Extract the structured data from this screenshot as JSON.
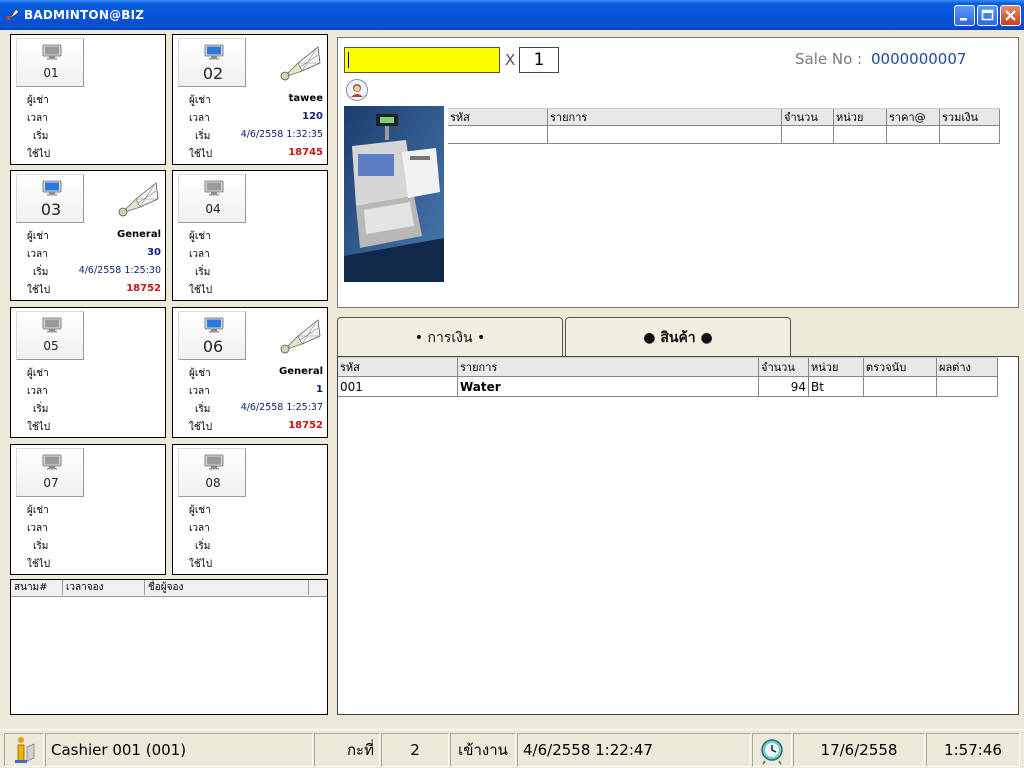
{
  "window": {
    "title": "BADMINTON@BIZ"
  },
  "courts": [
    {
      "number": "01",
      "busy": false,
      "renter": "",
      "time": "",
      "start": "",
      "used": ""
    },
    {
      "number": "02",
      "busy": true,
      "renter": "tawee",
      "time": "120",
      "start": "4/6/2558 1:32:35",
      "used": "18745"
    },
    {
      "number": "03",
      "busy": true,
      "renter": "General",
      "time": "30",
      "start": "4/6/2558 1:25:30",
      "used": "18752"
    },
    {
      "number": "04",
      "busy": false,
      "renter": "",
      "time": "",
      "start": "",
      "used": ""
    },
    {
      "number": "05",
      "busy": false,
      "renter": "",
      "time": "",
      "start": "",
      "used": ""
    },
    {
      "number": "06",
      "busy": true,
      "renter": "General",
      "time": "1",
      "start": "4/6/2558 1:25:37",
      "used": "18752"
    },
    {
      "number": "07",
      "busy": false,
      "renter": "",
      "time": "",
      "start": "",
      "used": ""
    },
    {
      "number": "08",
      "busy": false,
      "renter": "",
      "time": "",
      "start": "",
      "used": ""
    }
  ],
  "court_labels": {
    "renter": "ผู้เช่า",
    "time": "เวลา",
    "start": "เริ่ม",
    "used": "ใช้ไป"
  },
  "booking": {
    "columns": [
      "สนาม#",
      "เวลาจอง",
      "ชื่อผู้จอง"
    ]
  },
  "sale": {
    "barcode_value": "",
    "multiply_sign": "X",
    "quantity": "1",
    "sale_no_label": "Sale No :",
    "sale_no": "0000000007",
    "columns": [
      "รหัส",
      "รายการ",
      "จำนวน",
      "หน่วย",
      "ราคา@",
      "รวมเงิน"
    ]
  },
  "tabs": {
    "money": "• การเงิน •",
    "goods": "● สินค้า ●"
  },
  "goods": {
    "columns": [
      "รหัส",
      "รายการ",
      "จำนวน",
      "หน่วย",
      "ตรวจนับ",
      "ผลต่าง"
    ],
    "rows": [
      {
        "code": "001",
        "name": "Water",
        "qty": "94",
        "unit": "Bt",
        "count": "",
        "diff": ""
      }
    ]
  },
  "status": {
    "cashier": "Cashier 001 (001)",
    "shift_label": "กะที่",
    "shift_no": "2",
    "login_label": "เข้างาน",
    "login_time": "4/6/2558 1:22:47",
    "date": "17/6/2558",
    "clock": "1:57:46"
  },
  "colors": {
    "titlebar": "#0654d8",
    "barcode_bg": "#ffff00",
    "used_red": "#c81414",
    "time_blue": "#0a1e7a",
    "sale_no_blue": "#1d4a9c"
  },
  "icons": [
    "app-shuttlecock-icon",
    "monitor-icon",
    "shuttlecock-icon",
    "user-icon",
    "info-icon",
    "alarm-clock-icon",
    "minimize-icon",
    "maximize-icon",
    "close-icon"
  ]
}
